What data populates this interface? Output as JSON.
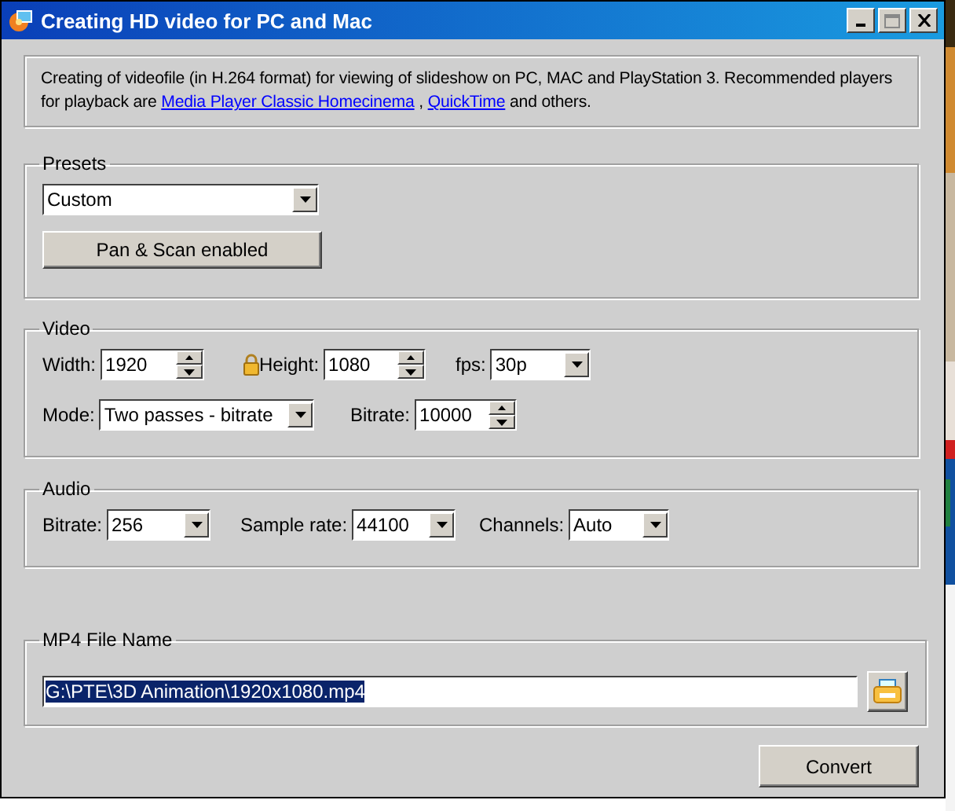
{
  "window": {
    "title": "Creating HD video for PC and Mac"
  },
  "description": [
    {
      "kind": "text",
      "text": "Creating of videofile (in H.264 format) for viewing of slideshow on PC, MAC and PlayStation 3. Recommended players for playback are "
    },
    {
      "kind": "link",
      "text": "Media Player Classic Homecinema"
    },
    {
      "kind": "text",
      "text": " , "
    },
    {
      "kind": "link",
      "text": "QuickTime"
    },
    {
      "kind": "text",
      "text": " and others."
    }
  ],
  "presets": {
    "title": "Presets",
    "value": "Custom",
    "pan_scan_button": "Pan & Scan enabled"
  },
  "video": {
    "title": "Video",
    "rows": [
      [
        {
          "kind": "spin",
          "label": "Width:",
          "value": "1920"
        },
        {
          "kind": "lock"
        },
        {
          "kind": "spin",
          "label": "Height:",
          "value": "1080"
        },
        {
          "kind": "combo",
          "label": "fps:",
          "value": "30p"
        }
      ],
      [
        {
          "kind": "combo",
          "label": "Mode:",
          "value": "Two passes - bitrate"
        },
        {
          "kind": "spin",
          "label": "Bitrate:",
          "value": "10000"
        }
      ]
    ]
  },
  "audio": {
    "title": "Audio",
    "rows": [
      [
        {
          "kind": "combo",
          "label": "Bitrate:",
          "value": "256"
        },
        {
          "kind": "combo",
          "label": "Sample rate:",
          "value": "44100"
        },
        {
          "kind": "combo",
          "label": "Channels:",
          "value": "Auto"
        }
      ]
    ]
  },
  "output": {
    "title": "MP4 File Name",
    "value": "G:\\PTE\\3D Animation\\1920x1080.mp4",
    "value_selected": true
  },
  "buttons": [
    {
      "label": "Convert"
    }
  ]
}
